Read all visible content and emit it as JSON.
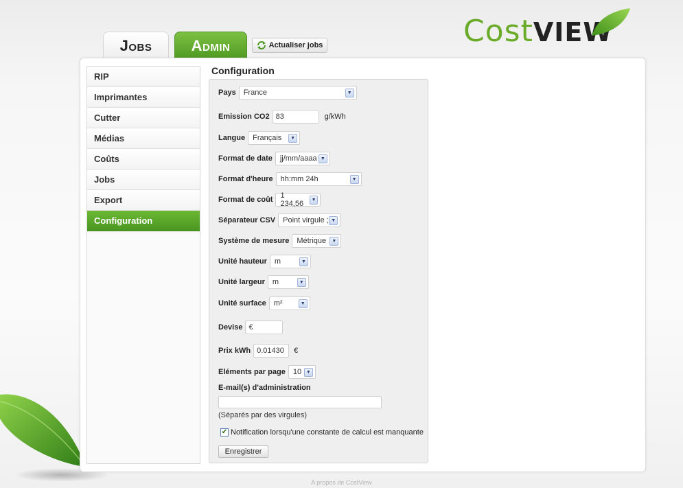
{
  "logo": {
    "cost": "Cost",
    "view": "VIEW",
    "accent_color": "#6aab2a"
  },
  "tabs": [
    {
      "label": "Jobs",
      "active": false
    },
    {
      "label": "Admin",
      "active": true
    }
  ],
  "toolbar": {
    "refresh_label": "Actualiser jobs",
    "refresh_icon": "refresh-icon"
  },
  "sidebar": {
    "items": [
      {
        "label": "RIP"
      },
      {
        "label": "Imprimantes"
      },
      {
        "label": "Cutter"
      },
      {
        "label": "Médias"
      },
      {
        "label": "Coûts"
      },
      {
        "label": "Jobs"
      },
      {
        "label": "Export"
      },
      {
        "label": "Configuration",
        "active": true
      }
    ]
  },
  "config": {
    "title": "Configuration",
    "pays": {
      "label": "Pays",
      "value": "France"
    },
    "co2": {
      "label": "Emission CO2",
      "value": "83",
      "unit": "g/kWh"
    },
    "langue": {
      "label": "Langue",
      "value": "Français"
    },
    "format_date": {
      "label": "Format de date",
      "value": "jj/mm/aaaa"
    },
    "format_heure": {
      "label": "Format d'heure",
      "value": "hh:mm 24h"
    },
    "format_cout": {
      "label": "Format de coût",
      "value": "1 234,56"
    },
    "separateur_csv": {
      "label": "Séparateur CSV",
      "value": "Point virgule ;"
    },
    "systeme_mesure": {
      "label": "Système de mesure",
      "value": "Métrique"
    },
    "unite_hauteur": {
      "label": "Unité hauteur",
      "value": "m"
    },
    "unite_largeur": {
      "label": "Unité largeur",
      "value": "m"
    },
    "unite_surface": {
      "label": "Unité surface",
      "value": "m²"
    },
    "devise": {
      "label": "Devise",
      "value": "€"
    },
    "prix_kwh": {
      "label": "Prix kWh",
      "value": "0.01430",
      "unit": "€"
    },
    "elements_page": {
      "label": "Eléments par page",
      "value": "10"
    },
    "email": {
      "label": "E-mail(s) d'administration",
      "value": "",
      "hint": "(Séparés par des virgules)"
    },
    "notification": {
      "label": "Notification lorsqu'une constante de calcul est manquante",
      "checked": true
    },
    "save_label": "Enregistrer"
  },
  "footer": {
    "about": "A propos de CostView"
  }
}
